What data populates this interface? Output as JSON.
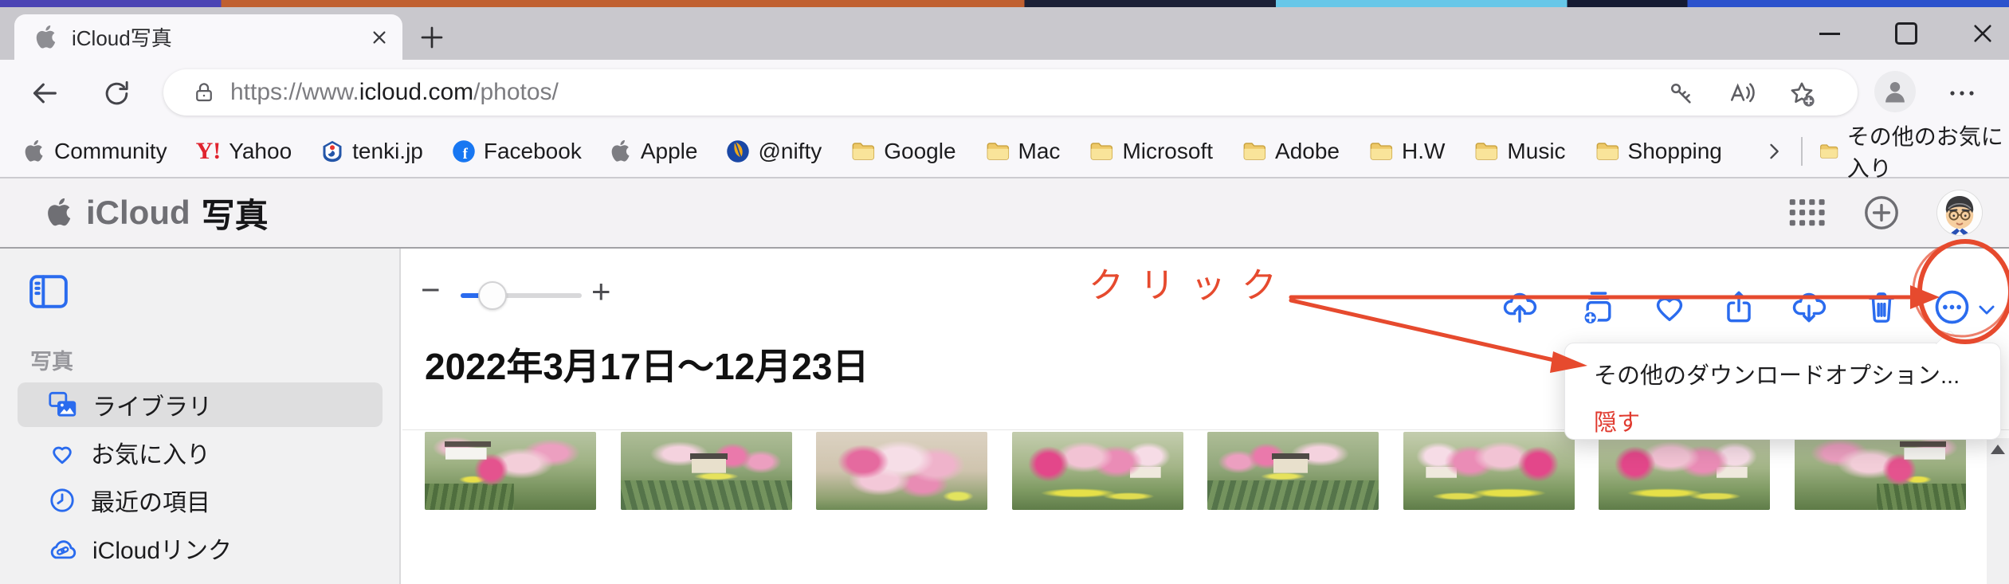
{
  "browser": {
    "tab_title": "iCloud写真",
    "url_scheme": "https://www.",
    "url_domain": "icloud.com",
    "url_path": "/photos/",
    "bookmarks": [
      {
        "label": "Community",
        "icon": "apple-icon"
      },
      {
        "label": "Yahoo",
        "icon": "yahoo-icon",
        "badge": "Y!"
      },
      {
        "label": "tenki.jp",
        "icon": "tenki-icon"
      },
      {
        "label": "Facebook",
        "icon": "facebook-icon",
        "badge": "f"
      },
      {
        "label": "Apple",
        "icon": "apple-icon"
      },
      {
        "label": "@nifty",
        "icon": "nifty-icon"
      },
      {
        "label": "Google",
        "icon": "folder-icon"
      },
      {
        "label": "Mac",
        "icon": "folder-icon"
      },
      {
        "label": "Microsoft",
        "icon": "folder-icon"
      },
      {
        "label": "Adobe",
        "icon": "folder-icon"
      },
      {
        "label": "H.W",
        "icon": "folder-icon"
      },
      {
        "label": "Music",
        "icon": "folder-icon"
      },
      {
        "label": "Shopping",
        "icon": "folder-icon"
      }
    ],
    "other_favorites_label": "その他のお気に入り"
  },
  "app_header": {
    "brand": "iCloud",
    "page": "写真"
  },
  "sidebar": {
    "section_label": "写真",
    "items": [
      {
        "label": "ライブラリ",
        "selected": true
      },
      {
        "label": "お気に入り",
        "selected": false
      },
      {
        "label": "最近の項目",
        "selected": false
      },
      {
        "label": "iCloudリンク",
        "selected": false
      }
    ]
  },
  "main": {
    "date_title": "2022年3月17日〜12月23日",
    "zoom_out_label": "−",
    "zoom_in_label": "+",
    "photo_count": 8
  },
  "dropdown_menu": {
    "items": [
      {
        "label": "その他のダウンロードオプション..."
      },
      {
        "label": "隠す"
      }
    ]
  },
  "annotation": {
    "click_text": "クリック"
  },
  "colors": {
    "accent_blue": "#2a6bee",
    "annotation_red": "#e64a2e",
    "menu_red": "#e0392e",
    "selected_row": "#dededf"
  }
}
